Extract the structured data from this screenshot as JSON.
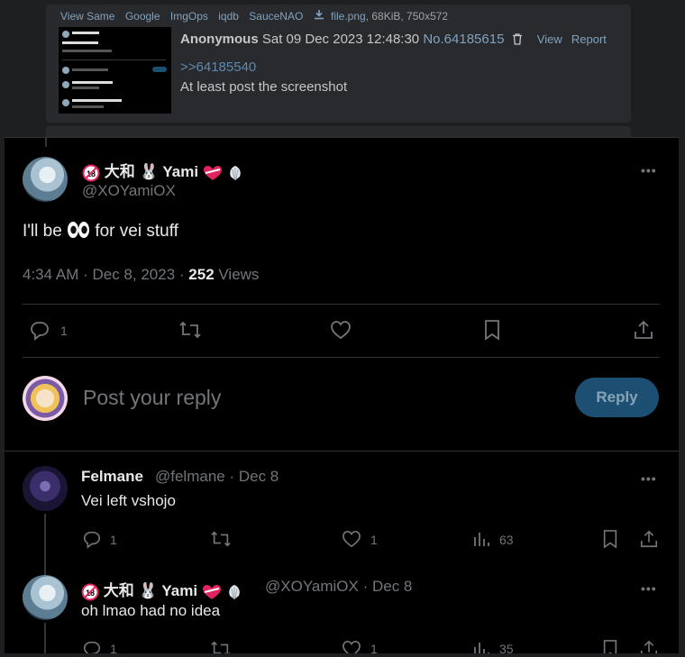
{
  "post": {
    "sauce_links": [
      "View Same",
      "Google",
      "ImgOps",
      "iqdb",
      "SauceNAO"
    ],
    "file_name": "file.png",
    "file_info": ", 68KiB, 750x572",
    "name": "Anonymous",
    "date": "Sat 09 Dec 2023 12:48:30",
    "number": "No.64185615",
    "view_label": "View",
    "report_label": "Report",
    "quote": ">>64185540",
    "text": "At least post the screenshot"
  },
  "tweet": {
    "name_prefix": "大和",
    "name_main": "Yami",
    "handle": "@XOYamiOX",
    "text_before": "I'll be",
    "text_after": "for vei stuff",
    "time": "4:34 AM · Dec 8, 2023 ·",
    "views_count": "252",
    "views_label": "Views",
    "reply_count": "1",
    "more": "•••"
  },
  "composer": {
    "placeholder": "Post your reply",
    "button": "Reply"
  },
  "replies": [
    {
      "name": "Felmane",
      "handle": "@felmane · Dec 8",
      "text": "Vei left vshojo",
      "replies": "1",
      "likes": "1",
      "views": "63"
    },
    {
      "name_prefix": "大和",
      "name_main": "Yami",
      "handle": "@XOYamiOX · Dec 8",
      "text": "oh lmao had no idea",
      "replies": "1",
      "likes": "1",
      "views": "35"
    }
  ],
  "colors": {
    "accent": "#1d9bf0",
    "link": "#81a2be",
    "quote": "#5f89ac",
    "muted": "#71767b"
  }
}
